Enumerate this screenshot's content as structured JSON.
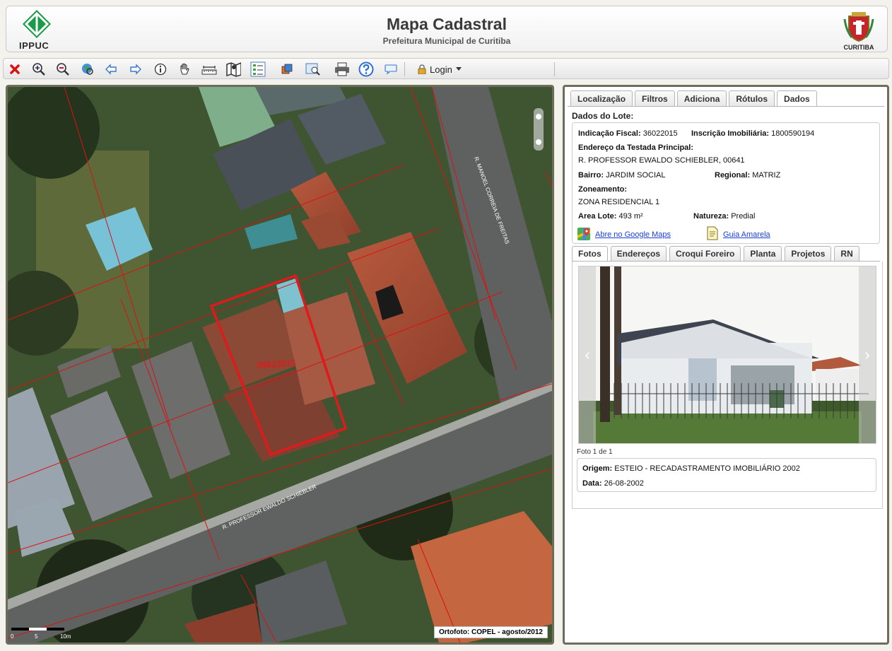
{
  "header": {
    "title": "Mapa Cadastral",
    "subtitle": "Prefeitura Municipal de Curitiba",
    "logo_left": "IPPUC",
    "logo_right": "CURITIBA"
  },
  "toolbar": {
    "icons": [
      "close-icon",
      "zoom-in-icon",
      "zoom-out-icon",
      "zoom-extent-icon",
      "back-arrow-icon",
      "forward-arrow-icon",
      "info-icon",
      "pan-hand-icon",
      "measure-icon",
      "map-icon",
      "legend-icon",
      "layers-icon",
      "search-icon",
      "print-icon",
      "help-icon",
      "comment-icon"
    ],
    "login_label": "Login"
  },
  "map": {
    "lot_label": "36022015",
    "street_1": "R. MANOEL CORREIA DE FREITAS",
    "street_2": "R. PROFESSOR EWALDO SCHIEBLER",
    "attribution": "Ortofoto: COPEL - agosto/2012",
    "scale_labels": [
      "0",
      "5",
      "10m"
    ]
  },
  "panel": {
    "tabs": [
      "Localização",
      "Filtros",
      "Adiciona",
      "Rótulos",
      "Dados"
    ],
    "active_tab": "Dados",
    "section_title": "Dados do Lote:",
    "lot": {
      "indicacao_label": "Indicação Fiscal:",
      "indicacao_value": "36022015",
      "inscricao_label": "Inscrição Imobiliária:",
      "inscricao_value": "1800590194",
      "endereco_label": "Endereço da Testada Principal:",
      "endereco_value": "R. PROFESSOR EWALDO SCHIEBLER, 00641",
      "bairro_label": "Bairro:",
      "bairro_value": "JARDIM SOCIAL",
      "regional_label": "Regional:",
      "regional_value": "MATRIZ",
      "zoneamento_label": "Zoneamento:",
      "zoneamento_value": "ZONA RESIDENCIAL 1",
      "area_label": "Area Lote:",
      "area_value": "493 m²",
      "natureza_label": "Natureza:",
      "natureza_value": "Predial",
      "google_link": "Abre no Google Maps",
      "guia_link": "Guia Amarela"
    },
    "subtabs": [
      "Fotos",
      "Endereços",
      "Croqui Foreiro",
      "Planta",
      "Projetos",
      "RN"
    ],
    "active_subtab": "Fotos",
    "photo": {
      "caption": "Foto 1 de 1",
      "origem_label": "Origem:",
      "origem_value": "ESTEIO - RECADASTRAMENTO IMOBILIÁRIO 2002",
      "data_label": "Data:",
      "data_value": "26-08-2002"
    }
  },
  "colors": {
    "lot_outline": "#e0191b",
    "frame": "#6a6e5a",
    "link": "#1a3fd8",
    "ippuc_green": "#1a9b47"
  }
}
